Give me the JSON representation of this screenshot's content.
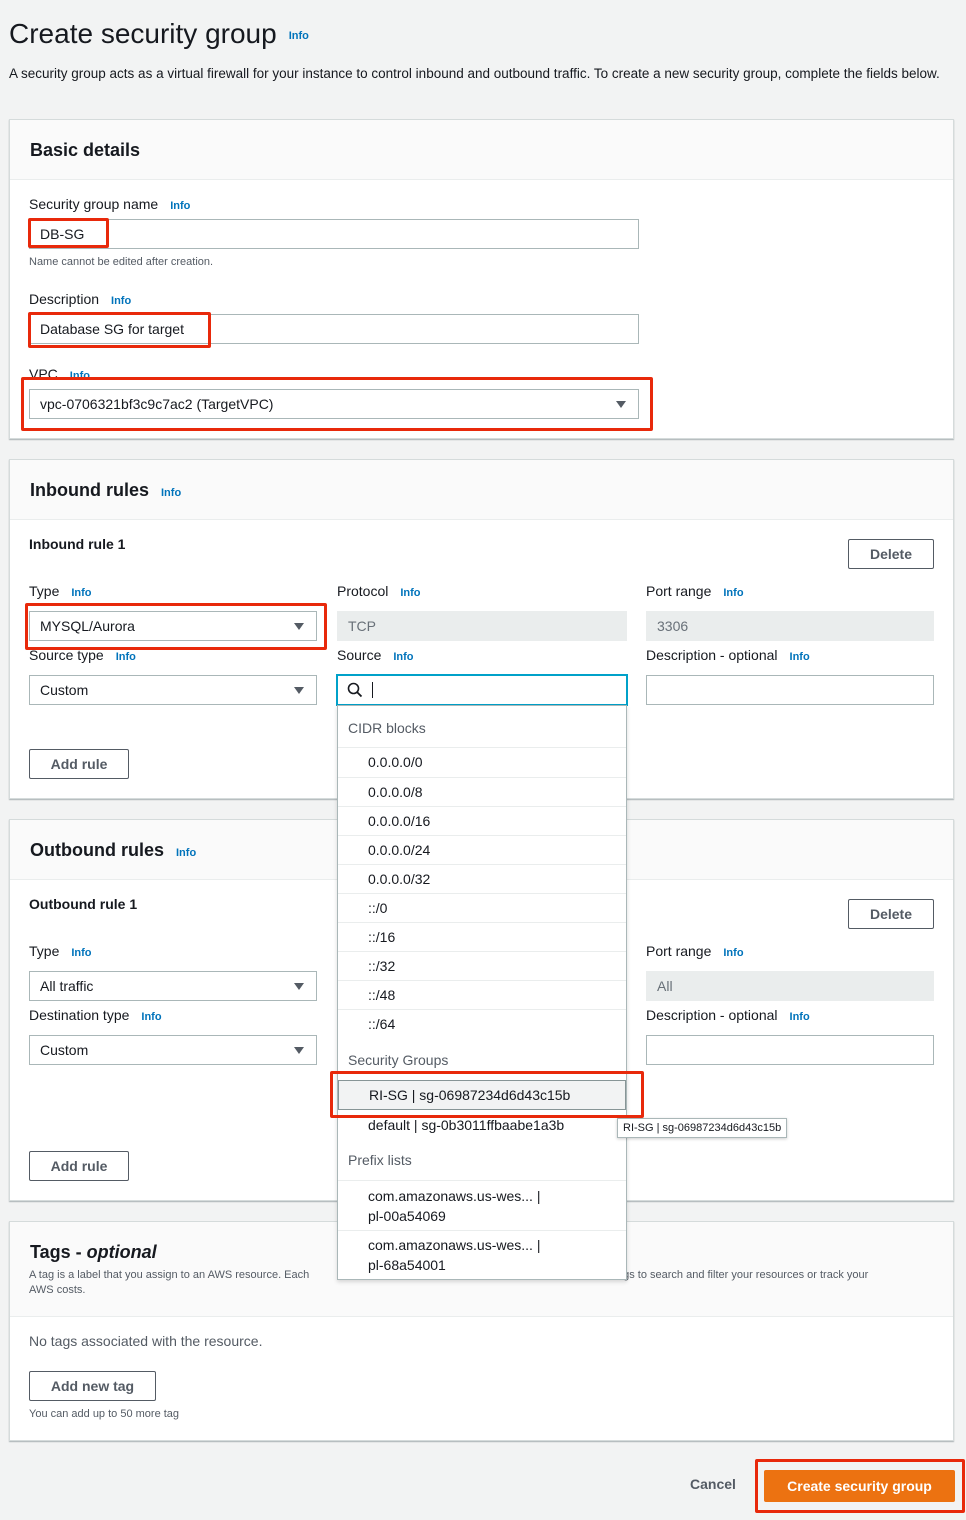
{
  "page": {
    "title": "Create security group",
    "info": "Info",
    "description": "A security group acts as a virtual firewall for your instance to control inbound and outbound traffic. To create a new security group, complete the fields below."
  },
  "basic": {
    "heading": "Basic details",
    "name_label": "Security group name",
    "name_value": "DB-SG",
    "name_hint": "Name cannot be edited after creation.",
    "desc_label": "Description",
    "desc_value": "Database SG for target",
    "vpc_label": "VPC",
    "vpc_value": "vpc-0706321bf3c9c7ac2 (TargetVPC)"
  },
  "inbound": {
    "heading": "Inbound rules",
    "rule_title": "Inbound rule 1",
    "delete": "Delete",
    "type_label": "Type",
    "type_value": "MYSQL/Aurora",
    "protocol_label": "Protocol",
    "protocol_value": "TCP",
    "port_label": "Port range",
    "port_value": "3306",
    "source_type_label": "Source type",
    "source_type_value": "Custom",
    "source_label": "Source",
    "source_value": "",
    "desc_label": "Description - optional",
    "add_rule": "Add rule"
  },
  "outbound": {
    "heading": "Outbound rules",
    "rule_title": "Outbound rule 1",
    "delete": "Delete",
    "type_label": "Type",
    "type_value": "All traffic",
    "port_label": "Port range",
    "port_value": "All",
    "dest_type_label": "Destination type",
    "dest_type_value": "Custom",
    "desc_label": "Description - optional",
    "add_rule": "Add rule"
  },
  "dropdown": {
    "cidr_heading": "CIDR blocks",
    "cidr": [
      "0.0.0.0/0",
      "0.0.0.0/8",
      "0.0.0.0/16",
      "0.0.0.0/24",
      "0.0.0.0/32",
      "::/0",
      "::/16",
      "::/32",
      "::/48",
      "::/64"
    ],
    "sg_heading": "Security Groups",
    "sg": [
      "RI-SG | sg-06987234d6d43c15b",
      "default | sg-0b3011ffbaabe1a3b"
    ],
    "prefix_heading": "Prefix lists",
    "prefix": [
      {
        "line1": "com.amazonaws.us-wes... |",
        "line2": "pl-00a54069"
      },
      {
        "line1": "com.amazonaws.us-wes... |",
        "line2": "pl-68a54001"
      }
    ],
    "tooltip": "RI-SG | sg-06987234d6d43c15b"
  },
  "tags": {
    "heading_main": "Tags - ",
    "heading_optional": "optional",
    "desc_left": "A tag is a label that you assign to an AWS resource. Each",
    "desc_right": "se tags to search and filter your resources or track your",
    "desc_line2": "AWS costs.",
    "empty": "No tags associated with the resource.",
    "add_tag": "Add new tag",
    "limit": "You can add up to 50 more tag"
  },
  "footer": {
    "cancel": "Cancel",
    "create": "Create security group"
  }
}
